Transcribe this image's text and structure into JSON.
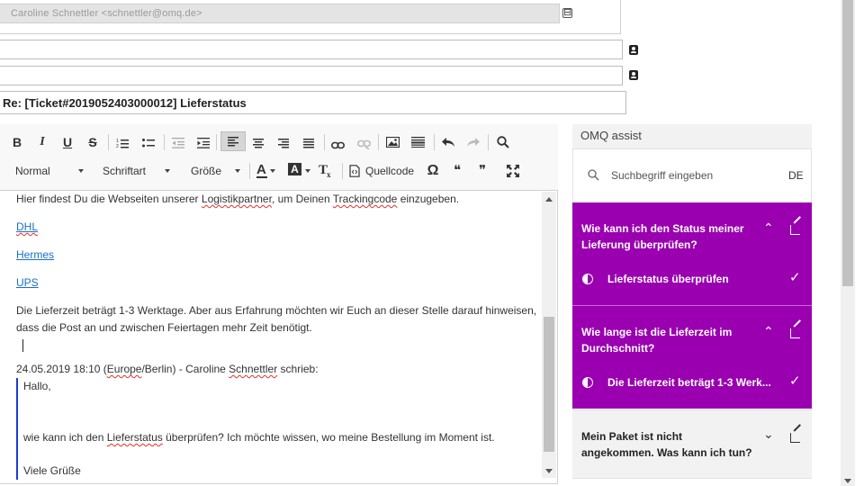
{
  "header": {
    "from_value": "Caroline Schnettler <schnettler@omq.de>",
    "to_value": "",
    "cc_value": "",
    "subject_value": "Re: [Ticket#2019052403000012] Lieferstatus",
    "collapse_symbol": "⊟"
  },
  "toolbar": {
    "bold": "B",
    "italic": "I",
    "underline": "U",
    "strike": "S",
    "format_label": "Normal",
    "font_label": "Schriftart",
    "size_label": "Größe",
    "text_color": "A",
    "bg_color": "A",
    "clear_format": "T",
    "source_label": "Quellcode",
    "omega": "Ω",
    "quote_open": "❝",
    "quote_close": "❞"
  },
  "body": {
    "intro_pre": "Hier findest Du die Webseiten unserer ",
    "intro_word1": "Logistikpartner",
    "intro_mid": ", um Deinen ",
    "intro_word2": "Trackingcode",
    "intro_post": " einzugeben.",
    "links": [
      "DHL",
      "Hermes",
      "UPS"
    ],
    "delivery_text": "Die Lieferzeit beträgt 1-3 Werktage. Aber aus Erfahrung möchten wir Euch an dieser Stelle darauf hinweisen, dass die Post an und zwischen Feiertagen mehr Zeit benötigt.",
    "quote_head_pre": "24.05.2019 18:10 (",
    "quote_head_europe": "Europe",
    "quote_head_mid": "/Berlin) - Caroline ",
    "quote_head_name": "Schnettler",
    "quote_head_post": " schrieb:",
    "quote_greeting": "Hallo,",
    "quote_line_pre": "wie kann ich den ",
    "quote_line_word": "Lieferstatus",
    "quote_line_post": " überprüfen? Ich möchte wissen, wo meine Bestellung im Moment ist.",
    "quote_closing": "Viele Grüße"
  },
  "omq": {
    "title": "OMQ assist",
    "search_placeholder": "Suchbegriff eingeben",
    "language": "DE",
    "accent_color": "#9a00b0",
    "cards": [
      {
        "question": "Wie kann ich den Status meiner Lieferung überprüfen?",
        "answer": "Lieferstatus überprüfen",
        "expanded": true
      },
      {
        "question": "Wie lange ist die Lieferzeit im Durchschnitt?",
        "answer": "Die Lieferzeit beträgt 1-3 Werk...",
        "expanded": true
      },
      {
        "question": "Mein Paket ist nicht angekommen. Was kann ich tun?",
        "answer": "",
        "expanded": false
      }
    ],
    "chevron_up": "⌃",
    "chevron_down": "⌄",
    "check": "✓"
  }
}
